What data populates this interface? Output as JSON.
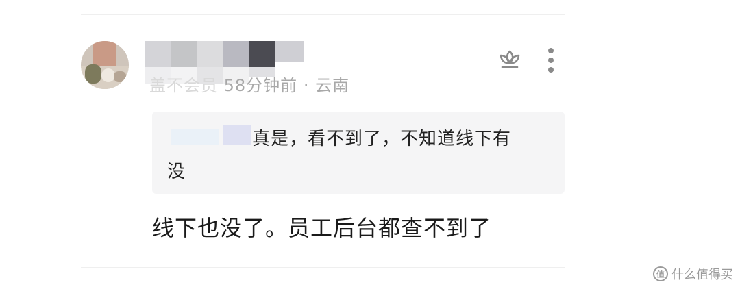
{
  "comment": {
    "meta_blurred": "盖不会员",
    "meta_time": "58分钟前",
    "meta_sep": " · ",
    "meta_location": "云南",
    "quote_line1": "真是，看不到了，不知道线下有",
    "quote_line2": "没",
    "reply": "线下也没了。员工后台都查不到了"
  },
  "watermark": {
    "text": "什么值得买"
  },
  "icons": {
    "like": "lotus-like-icon",
    "more": "more-vertical-icon",
    "watermark": "smzdm-logo-icon"
  },
  "colors": {
    "quote_background": "#f5f5f6",
    "meta_text": "#a8a8a8",
    "body_text": "#1a1a1a"
  }
}
